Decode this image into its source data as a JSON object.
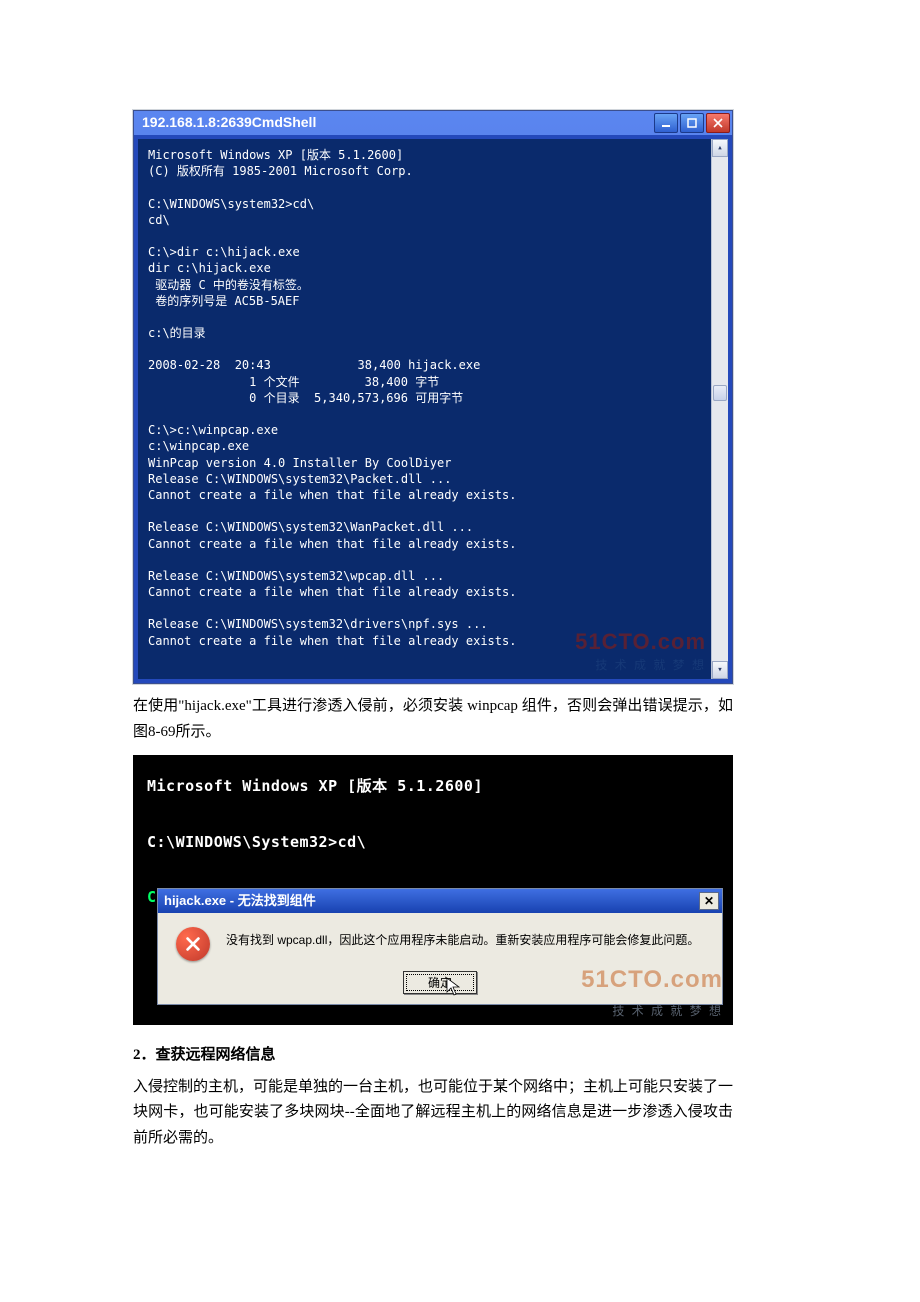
{
  "win1": {
    "title": "192.168.1.8:2639CmdShell",
    "terminal_lines": [
      "Microsoft Windows XP [版本 5.1.2600]",
      "(C) 版权所有 1985-2001 Microsoft Corp.",
      "",
      "C:\\WINDOWS\\system32>cd\\",
      "cd\\",
      "",
      "C:\\>dir c:\\hijack.exe",
      "dir c:\\hijack.exe",
      " 驱动器 C 中的卷没有标签。",
      " 卷的序列号是 AC5B-5AEF",
      "",
      "c:\\的目录",
      "",
      "2008-02-28  20:43            38,400 hijack.exe",
      "              1 个文件         38,400 字节",
      "              0 个目录  5,340,573,696 可用字节",
      "",
      "C:\\>c:\\winpcap.exe",
      "c:\\winpcap.exe",
      "WinPcap version 4.0 Installer By CoolDiyer",
      "Release C:\\WINDOWS\\system32\\Packet.dll ...",
      "Cannot create a file when that file already exists.",
      "",
      "Release C:\\WINDOWS\\system32\\WanPacket.dll ...",
      "Cannot create a file when that file already exists.",
      "",
      "Release C:\\WINDOWS\\system32\\wpcap.dll ...",
      "Cannot create a file when that file already exists.",
      "",
      "Release C:\\WINDOWS\\system32\\drivers\\npf.sys ...",
      "Cannot create a file when that file already exists."
    ]
  },
  "paragraph1": "在使用\"hijack.exe\"工具进行渗透入侵前，必须安装 winpcap 组件，否则会弹出错误提示，如图8-69所示。",
  "win2": {
    "cmd_lines": [
      "Microsoft Windows XP [版本 5.1.2600]",
      "",
      "C:\\WINDOWS\\System32>cd\\",
      "",
      "C:\\>hijack.exe"
    ],
    "dialog": {
      "title": "hijack.exe - 无法找到组件",
      "message": "没有找到 wpcap.dll，因此这个应用程序未能启动。重新安装应用程序可能会修复此问题。",
      "ok_label": "确定"
    }
  },
  "section_head": "2．查获远程网络信息",
  "paragraph2": "入侵控制的主机，可能是单独的一台主机，也可能位于某个网络中；主机上可能只安装了一块网卡，也可能安装了多块网块--全面地了解远程主机上的网络信息是进一步渗透入侵攻击前所必需的。",
  "watermark": {
    "main": "51CTO.com",
    "sub": "技 术 成 就 梦 想"
  }
}
